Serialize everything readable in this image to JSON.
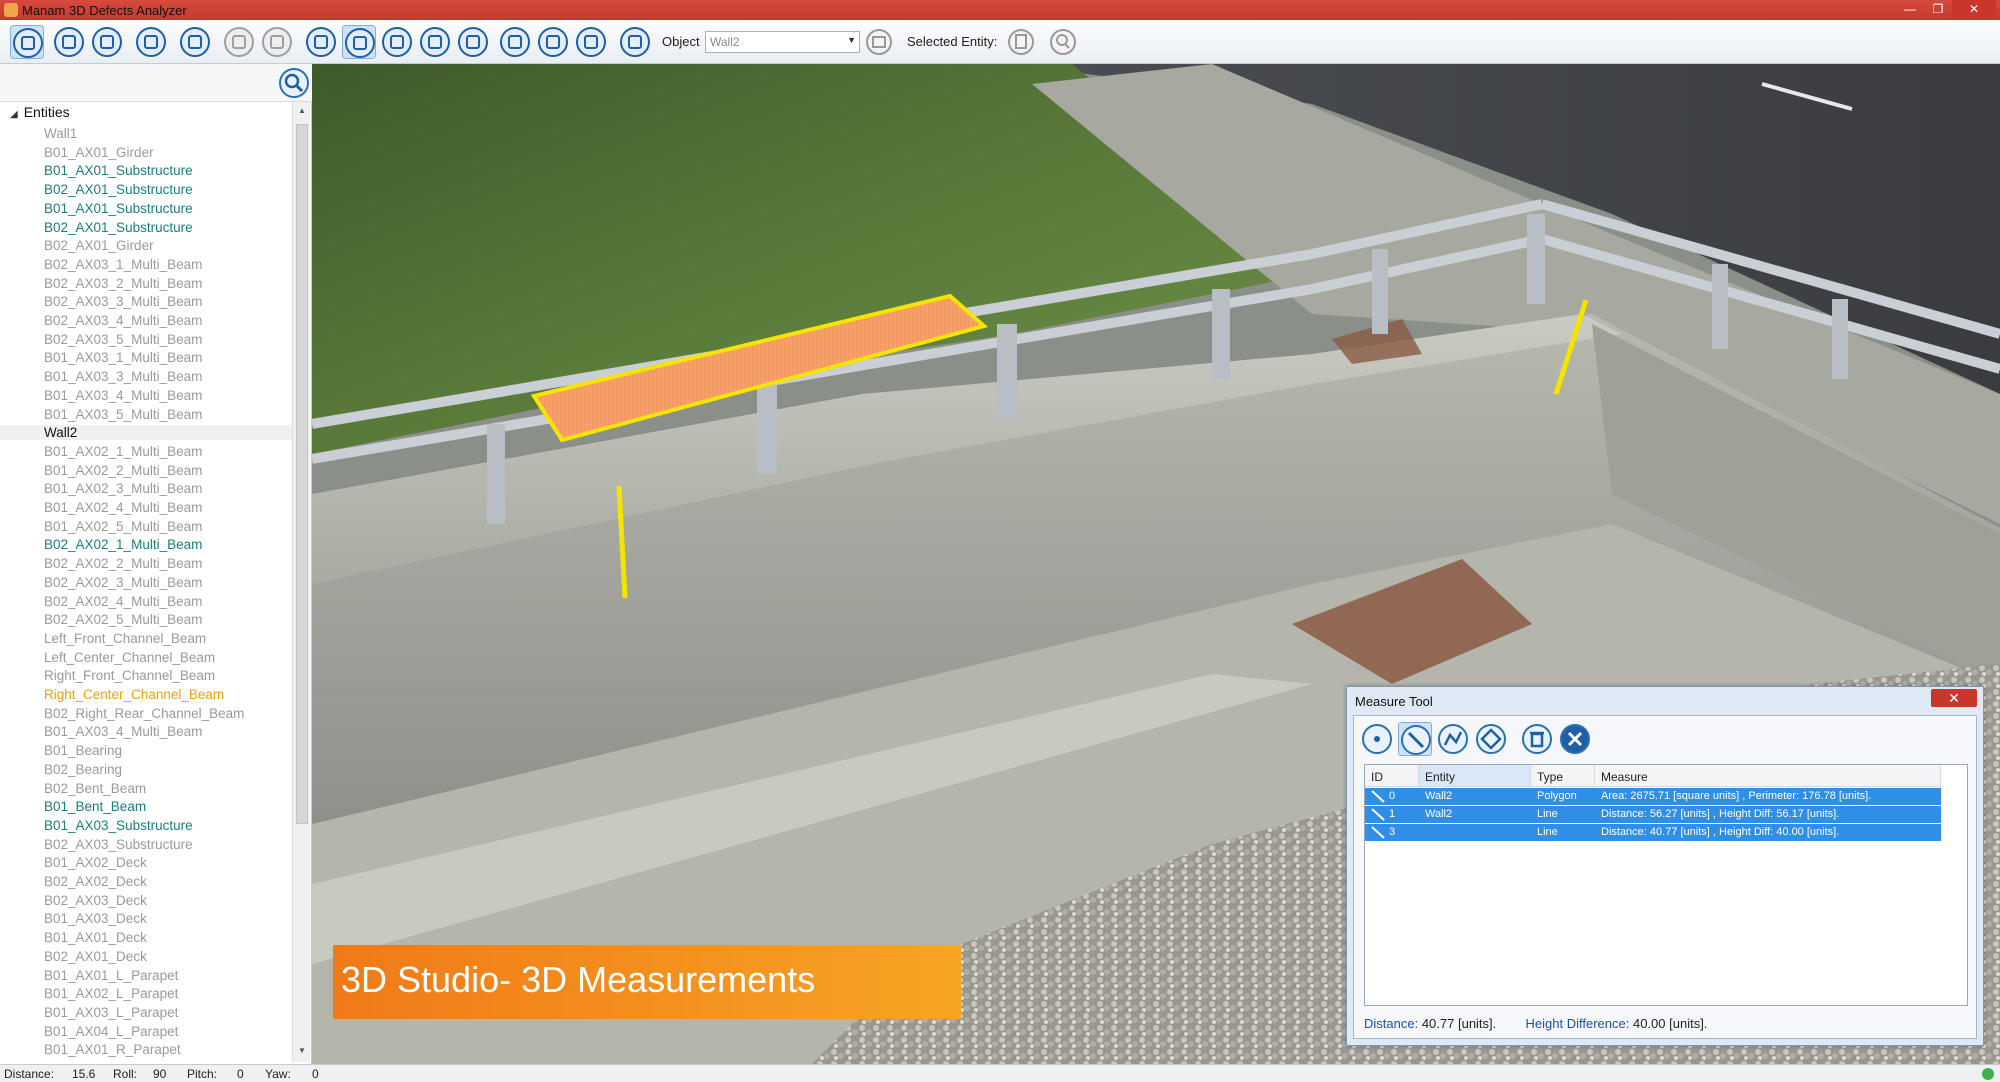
{
  "window": {
    "title": "Manam 3D Defects Analyzer"
  },
  "toolbar": {
    "buttons": [
      {
        "name": "entities-panel-button",
        "icon": "panel-icon"
      },
      {
        "name": "open-button",
        "icon": "folder-icon"
      },
      {
        "name": "save-button",
        "icon": "save-icon"
      },
      {
        "name": "model-button",
        "icon": "cube-icon"
      },
      {
        "name": "layers-button",
        "icon": "layers-icon"
      },
      {
        "name": "select-button",
        "icon": "pointer-icon"
      },
      {
        "name": "deselect-button",
        "icon": "pointer-cancel-icon"
      },
      {
        "name": "pan-button",
        "icon": "hand-icon"
      },
      {
        "name": "view-3d-button",
        "icon": "3d-icon"
      },
      {
        "name": "view-x-button",
        "icon": "axis-x-icon"
      },
      {
        "name": "view-y-button",
        "icon": "axis-y-icon"
      },
      {
        "name": "view-z-button",
        "icon": "axis-z-icon"
      },
      {
        "name": "look-button",
        "icon": "eye-icon"
      },
      {
        "name": "center-button",
        "icon": "crosshair-icon"
      },
      {
        "name": "fit-button",
        "icon": "fit-icon"
      },
      {
        "name": "settings-button",
        "icon": "gear-icon"
      }
    ],
    "object_label": "Object",
    "object_value": "Wall2",
    "selected_entity_label": "Selected Entity:"
  },
  "tree": {
    "root": "Entities",
    "items": [
      {
        "label": "Wall1",
        "color": "gray"
      },
      {
        "label": "B01_AX01_Girder",
        "color": "gray"
      },
      {
        "label": "B01_AX01_Substructure",
        "color": "teal"
      },
      {
        "label": "B02_AX01_Substructure",
        "color": "teal"
      },
      {
        "label": "B01_AX01_Substructure",
        "color": "teal"
      },
      {
        "label": "B02_AX01_Substructure",
        "color": "teal"
      },
      {
        "label": "B02_AX01_Girder",
        "color": "gray"
      },
      {
        "label": "B02_AX03_1_Multi_Beam",
        "color": "gray"
      },
      {
        "label": "B02_AX03_2_Multi_Beam",
        "color": "gray"
      },
      {
        "label": "B02_AX03_3_Multi_Beam",
        "color": "gray"
      },
      {
        "label": "B02_AX03_4_Multi_Beam",
        "color": "gray"
      },
      {
        "label": "B02_AX03_5_Multi_Beam",
        "color": "gray"
      },
      {
        "label": "B01_AX03_1_Multi_Beam",
        "color": "gray"
      },
      {
        "label": "B01_AX03_3_Multi_Beam",
        "color": "gray"
      },
      {
        "label": "B01_AX03_4_Multi_Beam",
        "color": "gray"
      },
      {
        "label": "B01_AX03_5_Multi_Beam",
        "color": "gray"
      },
      {
        "label": "Wall2",
        "color": "black",
        "selected": true
      },
      {
        "label": "B01_AX02_1_Multi_Beam",
        "color": "gray"
      },
      {
        "label": "B01_AX02_2_Multi_Beam",
        "color": "gray"
      },
      {
        "label": "B01_AX02_3_Multi_Beam",
        "color": "gray"
      },
      {
        "label": "B01_AX02_4_Multi_Beam",
        "color": "gray"
      },
      {
        "label": "B01_AX02_5_Multi_Beam",
        "color": "gray"
      },
      {
        "label": "B02_AX02_1_Multi_Beam",
        "color": "teal"
      },
      {
        "label": "B02_AX02_2_Multi_Beam",
        "color": "gray"
      },
      {
        "label": "B02_AX02_3_Multi_Beam",
        "color": "gray"
      },
      {
        "label": "B02_AX02_4_Multi_Beam",
        "color": "gray"
      },
      {
        "label": "B02_AX02_5_Multi_Beam",
        "color": "gray"
      },
      {
        "label": "Left_Front_Channel_Beam",
        "color": "gray"
      },
      {
        "label": "Left_Center_Channel_Beam",
        "color": "gray"
      },
      {
        "label": "Right_Front_Channel_Beam",
        "color": "gray"
      },
      {
        "label": "Right_Center_Channel_Beam",
        "color": "orange"
      },
      {
        "label": "B02_Right_Rear_Channel_Beam",
        "color": "gray"
      },
      {
        "label": "B01_AX03_4_Multi_Beam",
        "color": "gray"
      },
      {
        "label": "B01_Bearing",
        "color": "gray"
      },
      {
        "label": "B02_Bearing",
        "color": "gray"
      },
      {
        "label": "B02_Bent_Beam",
        "color": "gray"
      },
      {
        "label": "B01_Bent_Beam",
        "color": "teal"
      },
      {
        "label": "B01_AX03_Substructure",
        "color": "teal"
      },
      {
        "label": "B02_AX03_Substructure",
        "color": "gray"
      },
      {
        "label": "B01_AX02_Deck",
        "color": "gray"
      },
      {
        "label": "B02_AX02_Deck",
        "color": "gray"
      },
      {
        "label": "B02_AX03_Deck",
        "color": "gray"
      },
      {
        "label": "B01_AX03_Deck",
        "color": "gray"
      },
      {
        "label": "B01_AX01_Deck",
        "color": "gray"
      },
      {
        "label": "B02_AX01_Deck",
        "color": "gray"
      },
      {
        "label": "B01_AX01_L_Parapet",
        "color": "gray"
      },
      {
        "label": "B01_AX02_L_Parapet",
        "color": "gray"
      },
      {
        "label": "B01_AX03_L_Parapet",
        "color": "gray"
      },
      {
        "label": "B01_AX04_L_Parapet",
        "color": "gray"
      },
      {
        "label": "B01_AX01_R_Parapet",
        "color": "gray"
      }
    ]
  },
  "viewport": {
    "banner": "3D Studio- 3D Measurements",
    "highlight_color": "#f5a06a",
    "line_color": "#f5e400"
  },
  "measure_tool": {
    "title": "Measure Tool",
    "close_label": "✕",
    "columns": [
      "ID",
      "Entity",
      "Type",
      "Measure"
    ],
    "rows": [
      {
        "id": "0",
        "entity": "Wall2",
        "type": "Polygon",
        "measure": "Area: 2675.71 [square units] , Perimeter: 176.78 [units]."
      },
      {
        "id": "1",
        "entity": "Wall2",
        "type": "Line",
        "measure": "Distance: 56.27 [units] , Height Diff: 56.17 [units]."
      },
      {
        "id": "3",
        "entity": "",
        "type": "Line",
        "measure": "Distance: 40.77 [units] , Height Diff: 40.00 [units]."
      }
    ],
    "status": {
      "distance_label": "Distance:",
      "distance_value": "40.77 [units].",
      "height_label": "Height Difference:",
      "height_value": "40.00 [units]."
    }
  },
  "statusbar": {
    "distance_label": "Distance:",
    "distance_value": "15.6",
    "roll_label": "Roll:",
    "roll_value": "90",
    "pitch_label": "Pitch:",
    "pitch_value": "0",
    "yaw_label": "Yaw:",
    "yaw_value": "0"
  }
}
